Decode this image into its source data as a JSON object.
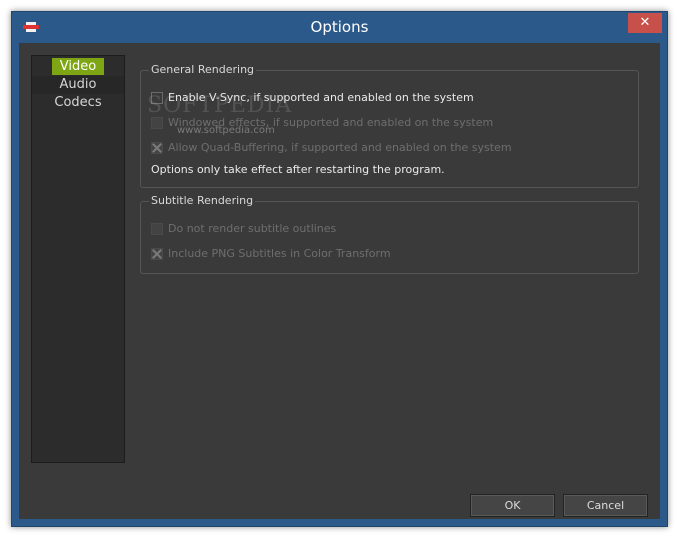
{
  "window": {
    "title": "Options",
    "close_label": "✕"
  },
  "sidebar": {
    "items": [
      {
        "label": "Video",
        "selected": true
      },
      {
        "label": "Audio",
        "selected": false
      },
      {
        "label": "Codecs",
        "selected": false
      }
    ]
  },
  "general_rendering": {
    "title": "General Rendering",
    "options": [
      {
        "label": "Enable V-Sync, if supported and enabled on the system",
        "checked": false,
        "enabled": true
      },
      {
        "label": "Windowed effects, if supported and enabled on the system",
        "checked": false,
        "enabled": false
      },
      {
        "label": "Allow Quad-Buffering, if supported and enabled on the system",
        "checked": true,
        "enabled": false
      }
    ],
    "note": "Options only take effect after restarting the program."
  },
  "subtitle_rendering": {
    "title": "Subtitle Rendering",
    "options": [
      {
        "label": "Do not render subtitle outlines",
        "checked": false,
        "enabled": false
      },
      {
        "label": "Include PNG Subtitles in Color Transform",
        "checked": true,
        "enabled": false
      }
    ]
  },
  "watermark": {
    "text": "SOFTPEDIA",
    "sub": "www.softpedia.com"
  },
  "buttons": {
    "ok": "OK",
    "cancel": "Cancel"
  },
  "colors": {
    "titlebar": "#2b5a8a",
    "accent": "#7ea614",
    "close": "#c7504b",
    "panel": "#3a3a3a"
  }
}
